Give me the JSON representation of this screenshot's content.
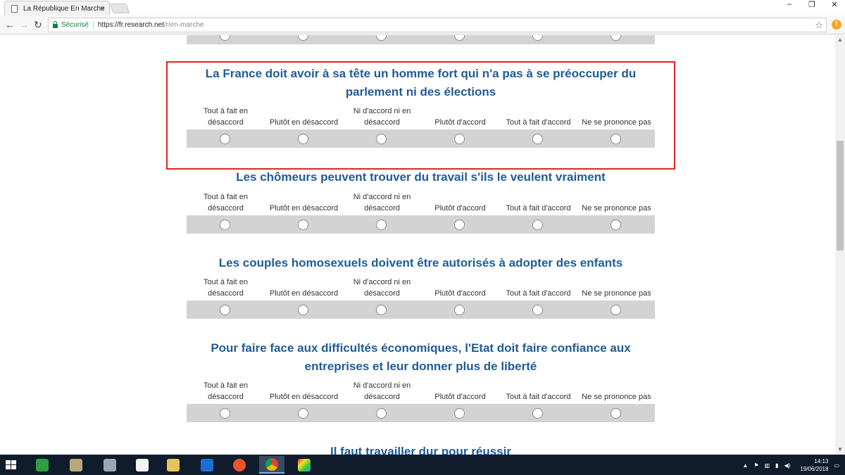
{
  "browser": {
    "tab_title": "La République En Marche",
    "secure_label": "Sécurisé",
    "url_host": "https://fr.research.net",
    "url_path": "/r/en-marche",
    "extension_badge": "!"
  },
  "scale_labels": {
    "l1": "Tout à fait en désaccord",
    "l2": "Plutôt en désaccord",
    "l3": "Ni d'accord ni en désaccord",
    "l4": "Plutôt d'accord",
    "l5": "Tout à fait d'accord",
    "l6": "Ne se prononce pas"
  },
  "questions": {
    "q1": "La France doit avoir à sa tête un homme fort qui n'a pas à se préoccuper du parlement ni des élections",
    "q2": "Les chômeurs peuvent trouver du travail s'ils le veulent vraiment",
    "q3": "Les couples homosexuels doivent être autorisés à adopter des enfants",
    "q4": "Pour faire face aux difficultés économiques, l'Etat doit faire confiance aux entreprises et leur donner plus de liberté",
    "q5": "Il faut travailler dur pour réussir"
  },
  "taskbar": {
    "time": "14:13",
    "date": "19/06/2018"
  },
  "colors": {
    "question_title": "#1f5c99",
    "highlight_border": "#e02424",
    "radio_bar": "#d3d3d3",
    "secure_green": "#0b8043"
  }
}
